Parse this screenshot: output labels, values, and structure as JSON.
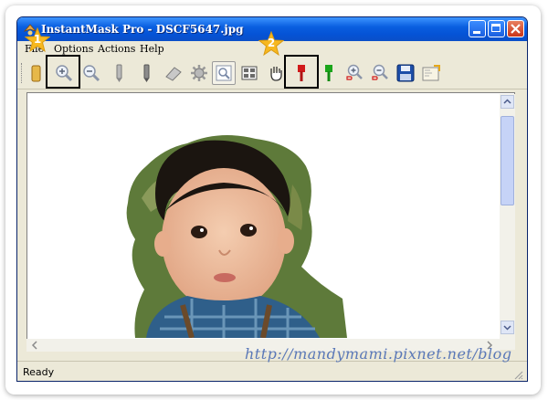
{
  "window": {
    "title": "InstantMask Pro - DSCF5647.jpg",
    "title_color": "#0553d6"
  },
  "menu": {
    "items": [
      "File",
      "Options",
      "Actions",
      "Help"
    ]
  },
  "toolbar": {
    "tools": [
      {
        "name": "open-folder-icon"
      },
      {
        "name": "zoom-in-icon"
      },
      {
        "name": "zoom-out-icon"
      },
      {
        "name": "pencil-gray-icon"
      },
      {
        "name": "pencil-dark-icon"
      },
      {
        "name": "eraser-icon"
      },
      {
        "name": "gear-icon"
      },
      {
        "name": "preview-icon"
      },
      {
        "name": "grid-view-icon"
      },
      {
        "name": "hand-pan-icon"
      },
      {
        "name": "red-brush-icon"
      },
      {
        "name": "green-brush-icon"
      },
      {
        "name": "brush-zoom-in-icon"
      },
      {
        "name": "brush-zoom-out-icon"
      },
      {
        "name": "save-disk-icon"
      },
      {
        "name": "export-icon"
      }
    ]
  },
  "callouts": [
    {
      "label": "1"
    },
    {
      "label": "2"
    }
  ],
  "status": {
    "text": "Ready"
  },
  "watermark": {
    "text": "http://mandymami.pixnet.net/blog"
  },
  "colors": {
    "highlight_border": "#000000",
    "star_fill": "#f7b81f"
  }
}
